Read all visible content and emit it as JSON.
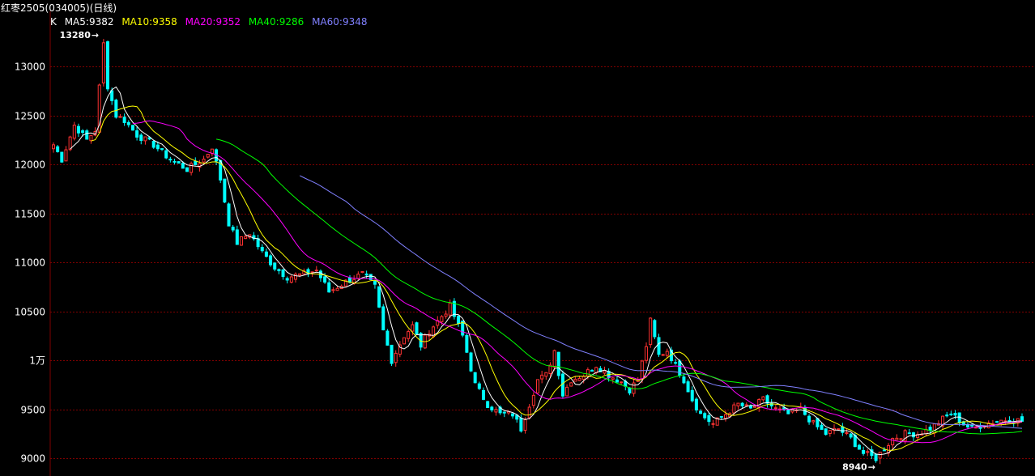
{
  "window": {
    "title": "红枣2505(034005)(日线)"
  },
  "legend": {
    "k_label": "K",
    "items": [
      {
        "label": "MA5:9382",
        "color": "#ffffff"
      },
      {
        "label": "MA10:9358",
        "color": "#ffff00"
      },
      {
        "label": "MA20:9352",
        "color": "#ff00ff"
      },
      {
        "label": "MA40:9286",
        "color": "#00ff00"
      },
      {
        "label": "MA60:9348",
        "color": "#8080ff"
      }
    ]
  },
  "colors": {
    "up": "#ff3232",
    "down": "#00ffff",
    "grid": "#800000",
    "background": "#000000"
  },
  "chart_data": {
    "type": "candlestick",
    "ylim": [
      8880,
      13420
    ],
    "y_ticks": [
      {
        "value": 9000,
        "label": "9000"
      },
      {
        "value": 9500,
        "label": "9500"
      },
      {
        "value": 10000,
        "label": "1万"
      },
      {
        "value": 10500,
        "label": "10500"
      },
      {
        "value": 11000,
        "label": "11000"
      },
      {
        "value": 11500,
        "label": "11500"
      },
      {
        "value": 12000,
        "label": "12000"
      },
      {
        "value": 12500,
        "label": "12500"
      },
      {
        "value": 13000,
        "label": "13000"
      }
    ],
    "annotations": [
      {
        "label": "13280",
        "value": 13280,
        "index": 12
      },
      {
        "label": "8940",
        "value": 8940,
        "index": 198
      }
    ],
    "keypoints": [
      [
        0,
        12200
      ],
      [
        2,
        12050
      ],
      [
        5,
        12400
      ],
      [
        8,
        12250
      ],
      [
        10,
        12350
      ],
      [
        12,
        13230
      ],
      [
        13,
        12800
      ],
      [
        15,
        12500
      ],
      [
        17,
        12450
      ],
      [
        20,
        12300
      ],
      [
        24,
        12200
      ],
      [
        28,
        12050
      ],
      [
        32,
        11950
      ],
      [
        36,
        12050
      ],
      [
        38,
        12180
      ],
      [
        40,
        11850
      ],
      [
        42,
        11400
      ],
      [
        44,
        11200
      ],
      [
        47,
        11300
      ],
      [
        50,
        11100
      ],
      [
        53,
        10950
      ],
      [
        56,
        10850
      ],
      [
        60,
        10880
      ],
      [
        63,
        10920
      ],
      [
        66,
        10700
      ],
      [
        70,
        10800
      ],
      [
        74,
        10880
      ],
      [
        77,
        10750
      ],
      [
        79,
        10300
      ],
      [
        81,
        10000
      ],
      [
        84,
        10250
      ],
      [
        86,
        10350
      ],
      [
        88,
        10150
      ],
      [
        90,
        10300
      ],
      [
        92,
        10400
      ],
      [
        95,
        10550
      ],
      [
        98,
        10250
      ],
      [
        101,
        9750
      ],
      [
        104,
        9550
      ],
      [
        107,
        9450
      ],
      [
        110,
        9450
      ],
      [
        112,
        9300
      ],
      [
        114,
        9550
      ],
      [
        116,
        9800
      ],
      [
        118,
        9850
      ],
      [
        120,
        10100
      ],
      [
        122,
        9650
      ],
      [
        124,
        9800
      ],
      [
        127,
        9850
      ],
      [
        130,
        9950
      ],
      [
        133,
        9850
      ],
      [
        136,
        9780
      ],
      [
        138,
        9700
      ],
      [
        140,
        9800
      ],
      [
        142,
        10150
      ],
      [
        143,
        10400
      ],
      [
        145,
        10050
      ],
      [
        147,
        10100
      ],
      [
        149,
        9950
      ],
      [
        151,
        9800
      ],
      [
        153,
        9600
      ],
      [
        155,
        9450
      ],
      [
        158,
        9350
      ],
      [
        161,
        9450
      ],
      [
        164,
        9550
      ],
      [
        167,
        9500
      ],
      [
        170,
        9600
      ],
      [
        173,
        9500
      ],
      [
        176,
        9450
      ],
      [
        179,
        9500
      ],
      [
        182,
        9350
      ],
      [
        185,
        9250
      ],
      [
        188,
        9300
      ],
      [
        191,
        9200
      ],
      [
        194,
        9050
      ],
      [
        197,
        9000
      ],
      [
        199,
        9100
      ],
      [
        201,
        9200
      ],
      [
        204,
        9250
      ],
      [
        207,
        9250
      ],
      [
        210,
        9300
      ],
      [
        213,
        9400
      ],
      [
        215,
        9450
      ],
      [
        218,
        9350
      ],
      [
        220,
        9300
      ],
      [
        223,
        9350
      ],
      [
        226,
        9380
      ],
      [
        229,
        9400
      ],
      [
        232,
        9380
      ]
    ],
    "moving_averages": [
      {
        "label": "MA5",
        "period": 5,
        "color": "#ffffff"
      },
      {
        "label": "MA10",
        "period": 10,
        "color": "#ffff00"
      },
      {
        "label": "MA20",
        "period": 20,
        "color": "#ff00ff"
      },
      {
        "label": "MA40",
        "period": 40,
        "color": "#00ff00"
      },
      {
        "label": "MA60",
        "period": 60,
        "color": "#8080ff"
      }
    ]
  }
}
